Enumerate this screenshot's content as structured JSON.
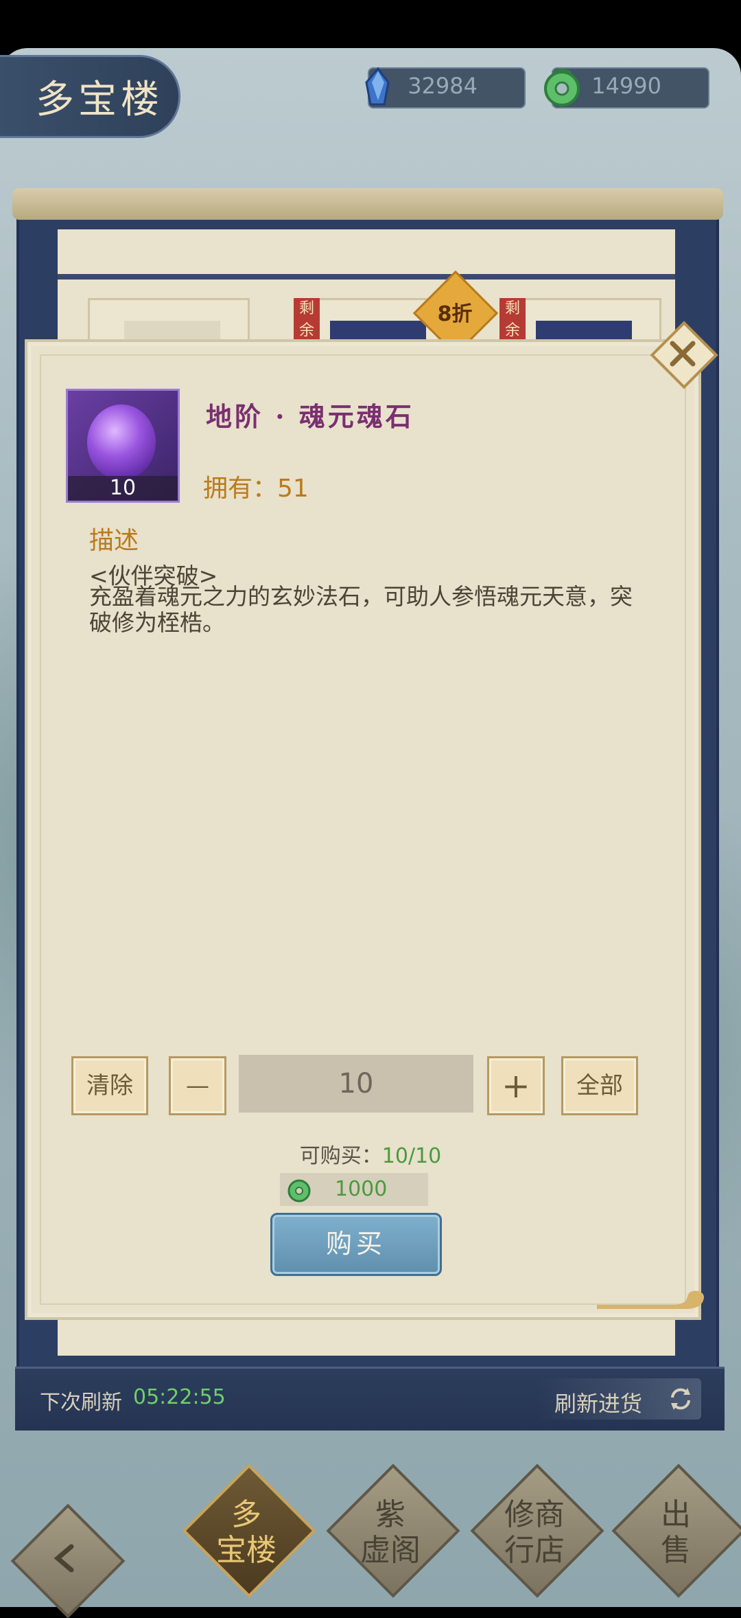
{
  "header": {
    "title": "多宝楼",
    "currencies": [
      {
        "icon": "blue-crystal-icon",
        "value": "32984"
      },
      {
        "icon": "jade-coin-icon",
        "value": "14990"
      }
    ]
  },
  "shop_background": {
    "remain_tag": "剩余",
    "discount_tag": "8折"
  },
  "dialog": {
    "item_count": "10",
    "item_name": "地阶 · 魂元魂石",
    "owned_label": "拥有：51",
    "desc_title": "描述",
    "desc_subtitle": "<伙伴突破>",
    "desc_body": "充盈着魂元之力的玄妙法石，可助人参悟魂元天意，突破修为桎梏。",
    "clear_label": "清除",
    "minus_label": "—",
    "quantity": "10",
    "plus_label": "+",
    "all_label": "全部",
    "purchasable_label": "可购买：",
    "purchasable_value": "10/10",
    "price": "1000",
    "buy_label": "购买"
  },
  "footer": {
    "refresh_label": "下次刷新",
    "refresh_time": "05:22:55",
    "restock_label": "刷新进货"
  },
  "nav": [
    {
      "label_top": "多",
      "label_bottom": "宝楼",
      "active": true
    },
    {
      "label_top": "紫",
      "label_bottom": "虚阁",
      "active": false
    },
    {
      "label_top": "修商",
      "label_bottom": "行店",
      "active": false
    },
    {
      "label_top": "出",
      "label_bottom": "售",
      "active": false
    }
  ],
  "colors": {
    "accent_gold": "#b97b1c",
    "item_name_purple": "#7a2f70",
    "price_green": "#4a9a3e",
    "buy_button_blue": "#6d9dbb"
  }
}
